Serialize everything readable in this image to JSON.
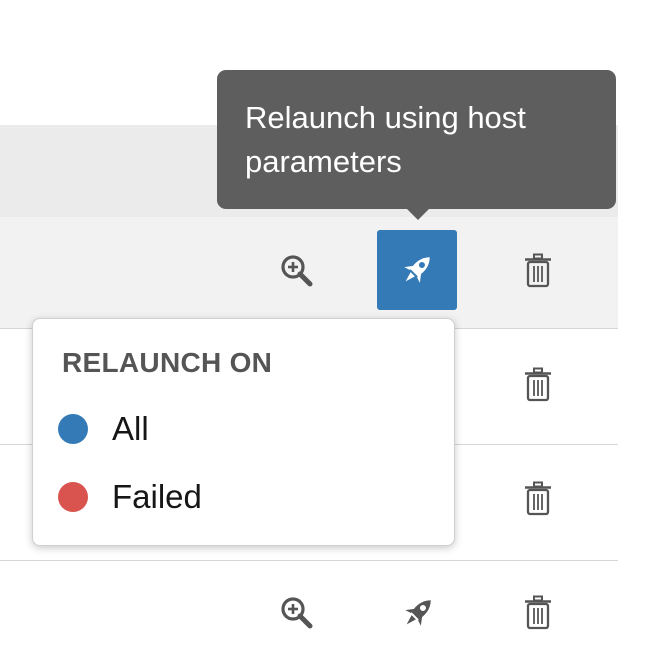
{
  "tooltip": {
    "text": "Relaunch using host parameters"
  },
  "relaunch_menu": {
    "heading": "RELAUNCH ON",
    "options": [
      {
        "label": "All",
        "color": "#337ab7"
      },
      {
        "label": "Failed",
        "color": "#d9534f"
      }
    ]
  },
  "rows": [
    {
      "actions": [
        "zoom-icon",
        "rocket-icon",
        "trash-icon"
      ],
      "relaunch_active": true
    },
    {
      "actions": [
        "trash-icon"
      ]
    },
    {
      "actions": [
        "trash-icon"
      ]
    },
    {
      "actions": [
        "zoom-icon",
        "rocket-icon",
        "trash-icon"
      ]
    }
  ],
  "colors": {
    "accent": "#337ab7",
    "tooltip_bg": "#5e5e5e",
    "icon": "#555555"
  }
}
